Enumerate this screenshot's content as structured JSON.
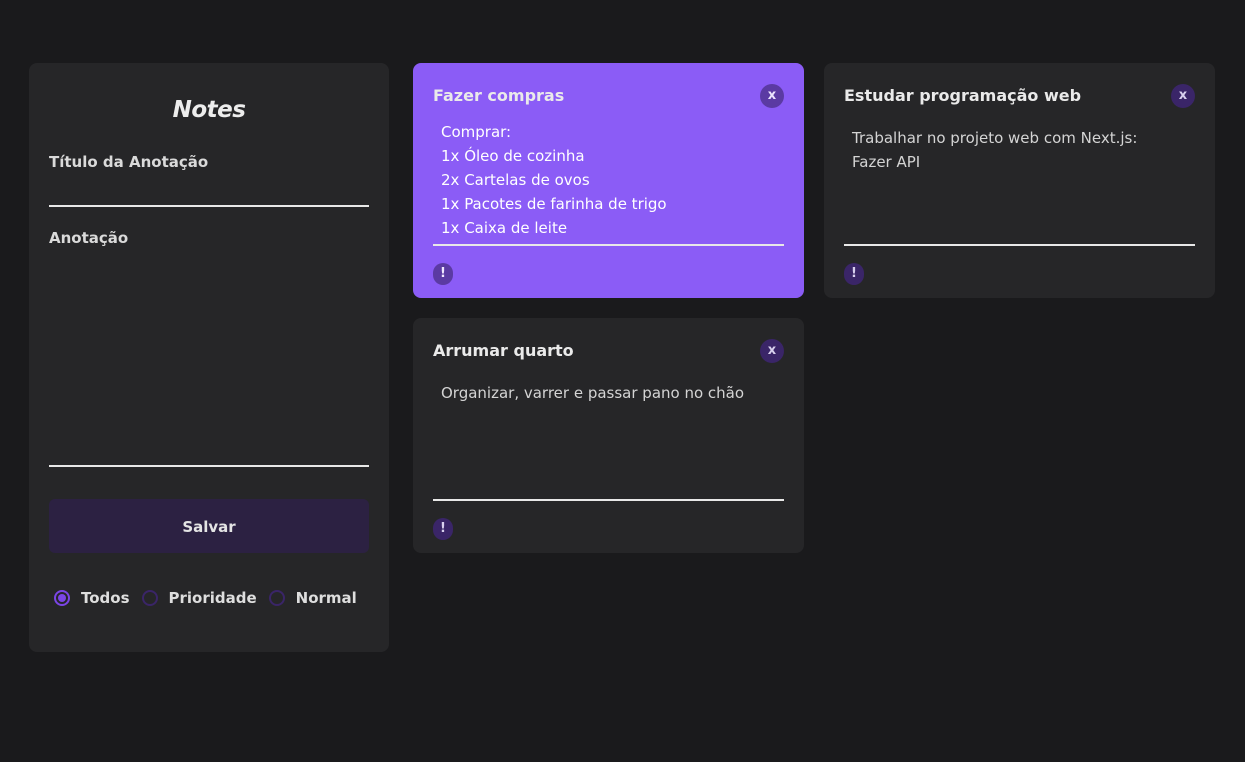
{
  "form": {
    "title": "Notes",
    "title_label": "Título da Anotação",
    "title_value": "",
    "note_label": "Anotação",
    "note_value": "",
    "save_label": "Salvar",
    "filters": [
      {
        "label": "Todos",
        "selected": true
      },
      {
        "label": "Prioridade",
        "selected": false
      },
      {
        "label": "Normal",
        "selected": false
      }
    ]
  },
  "notes": [
    {
      "title": "Fazer compras",
      "body": "Comprar:\n1x Óleo de cozinha\n2x Cartelas de ovos\n1x Pacotes de farinha de trigo\n1x Caixa de leite",
      "priority": true,
      "close_label": "x",
      "priority_label": "!"
    },
    {
      "title": "Estudar programação web",
      "body": "Trabalhar no projeto web com Next.js:\nFazer API",
      "priority": false,
      "close_label": "x",
      "priority_label": "!"
    },
    {
      "title": "Arrumar quarto",
      "body": "Organizar, varrer e passar pano no chão",
      "priority": false,
      "close_label": "x",
      "priority_label": "!"
    }
  ],
  "colors": {
    "background": "#1a1a1c",
    "panel": "#262628",
    "accent": "#8b5cf6",
    "accent_dark": "#3a2568",
    "button": "#2c2142"
  }
}
